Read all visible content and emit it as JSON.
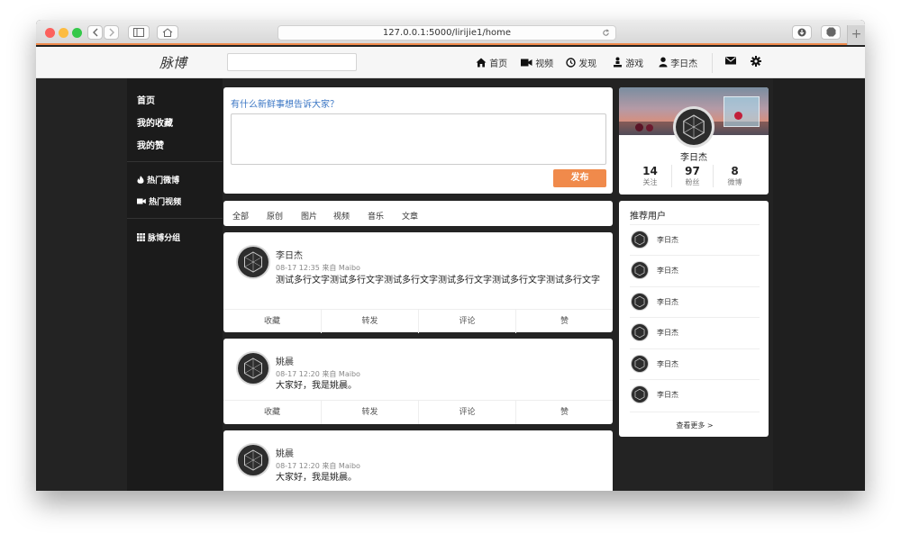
{
  "browser": {
    "url": "127.0.0.1:5000/lirijie1/home",
    "colors": {
      "accent": "#f08a4b"
    }
  },
  "nav": {
    "brand": "脉博",
    "search": {
      "value": "",
      "placeholder": ""
    },
    "links": [
      {
        "icon": "home-icon",
        "label": "首页"
      },
      {
        "icon": "video-camera-icon",
        "label": "视频"
      },
      {
        "icon": "compass-icon",
        "label": "发现"
      },
      {
        "icon": "game-icon",
        "label": "游戏"
      },
      {
        "icon": "user-icon",
        "label": "李日杰"
      }
    ]
  },
  "sidebar": {
    "main": [
      "首页",
      "我的收藏",
      "我的赞"
    ],
    "hot_weibo": "热门微博",
    "hot_video": "热门视频",
    "groups": "脉博分组"
  },
  "composer": {
    "prompt": "有什么新鲜事想告诉大家？",
    "text": "",
    "publish_label": "发布"
  },
  "filter_tabs": [
    "全部",
    "原创",
    "图片",
    "视频",
    "音乐",
    "文章"
  ],
  "posts": [
    {
      "author": "李日杰",
      "meta": "08-17 12:35 来自 Maibo",
      "text": "测试多行文字测试多行文字测试多行文字测试多行文字测试多行文字测试多行文字",
      "actions": [
        "收藏",
        "转发",
        "评论",
        "赞"
      ]
    },
    {
      "author": "姚晨",
      "meta": "08-17 12:20 来自 Maibo",
      "text": "大家好，我是姚晨。",
      "actions": [
        "收藏",
        "转发",
        "评论",
        "赞"
      ]
    },
    {
      "author": "姚晨",
      "meta": "08-17 12:20 来自 Maibo",
      "text": "大家好，我是姚晨。"
    }
  ],
  "profile": {
    "name": "李日杰",
    "stats": [
      {
        "value": "14",
        "label": "关注"
      },
      {
        "value": "97",
        "label": "粉丝"
      },
      {
        "value": "8",
        "label": "微博"
      }
    ]
  },
  "recommend": {
    "title": "推荐用户",
    "users": [
      "李日杰",
      "李日杰",
      "李日杰",
      "李日杰",
      "李日杰",
      "李日杰"
    ],
    "more_label": "查看更多 >"
  }
}
